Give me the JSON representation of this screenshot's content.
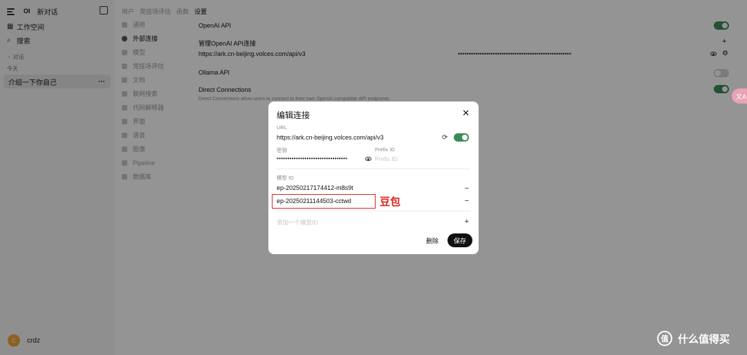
{
  "sidebar": {
    "logo": "OI",
    "new_chat": "新对话",
    "workspace": "工作空间",
    "search": "搜索",
    "section_chats": "对话",
    "group_today": "今天",
    "chat_item": "介绍一下你自己",
    "user": {
      "initial": "C",
      "name": "crdz"
    }
  },
  "settings": {
    "tabs": [
      "用户",
      "竞技场评估",
      "函数",
      "设置"
    ],
    "active_tab": "设置",
    "nav": [
      "通用",
      "外部连接",
      "模型",
      "竞技场评估",
      "文档",
      "联网搜索",
      "代码解释器",
      "界面",
      "语音",
      "图像",
      "Pipeline",
      "数据库"
    ],
    "active_nav": "外部连接",
    "openai_api": "OpenAI API",
    "manage_openai": "管理OpenAI API连接",
    "openai_url": "https://ark.cn-beijing.volces.com/api/v3",
    "ollama_api": "Ollama API",
    "direct_connections": "Direct Connections",
    "direct_desc": "Direct Connections allow users to connect to their own OpenAI compatible API endpoints."
  },
  "modal": {
    "title": "编辑连接",
    "url_label": "URL",
    "url_value": "https://ark.cn-beijing.volces.com/api/v3",
    "key_label": "密钥",
    "prefix_label": "Prefix ID",
    "prefix_placeholder": "Prefix ID",
    "model_id_label": "模型 ID",
    "models": [
      "ep-20250217174412-m8s9t",
      "ep-20250211144503-cctwd"
    ],
    "add_model_placeholder": "添加一个模型ID",
    "delete": "删除",
    "save": "保存"
  },
  "annotation": {
    "label": "豆包",
    "color": "#e0211f"
  },
  "translate_badge": "文A",
  "watermark": {
    "symbol": "值",
    "text": "什么值得买"
  },
  "colors": {
    "toggle_on": "#3e8a59",
    "overlay": "rgba(0,0,0,0.42)",
    "save_button": "#111111"
  }
}
